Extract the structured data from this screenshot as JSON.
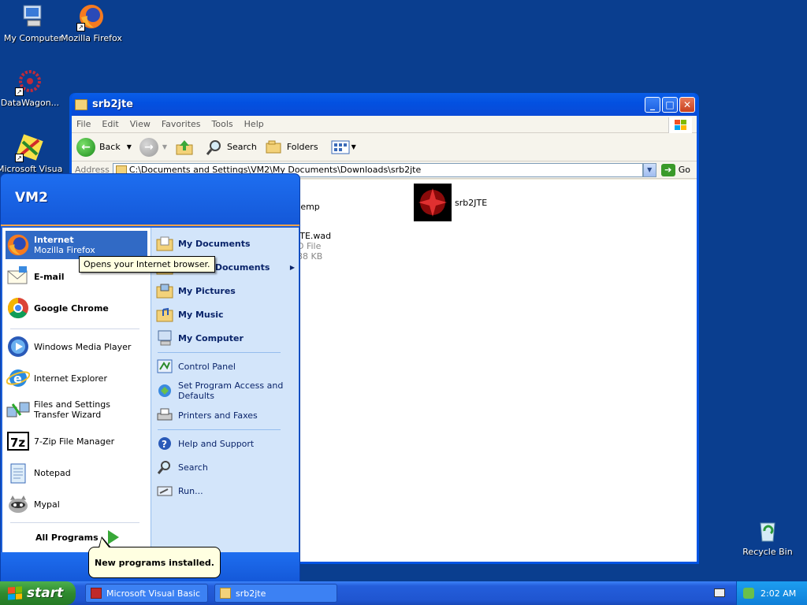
{
  "desktop": {
    "icons": [
      {
        "label": "My Computer",
        "icon": "my-computer-icon"
      },
      {
        "label": "Mozilla Firefox",
        "icon": "firefox-icon"
      },
      {
        "label": "DataWagon...",
        "icon": "datawagon-icon"
      },
      {
        "label": "Microsoft Visual...",
        "icon": "visual-basic-icon"
      },
      {
        "label": "Recycle Bin",
        "icon": "recycle-bin-icon"
      }
    ]
  },
  "window": {
    "title": "srb2jte",
    "menu": [
      "File",
      "Edit",
      "View",
      "Favorites",
      "Tools",
      "Help"
    ],
    "toolbar": {
      "back": "Back",
      "search": "Search",
      "folders": "Folders"
    },
    "address": {
      "label": "Address",
      "value": "C:\\Documents and Settings\\VM2\\My Documents\\Downloads\\srb2jte",
      "go": "Go"
    },
    "files": [
      {
        "name": "temp",
        "type": "",
        "size": ""
      },
      {
        "name": "srb2JTE",
        "type": "",
        "size": ""
      },
      {
        "name": "JTE.wad",
        "type": "D File",
        "size": "88 KB"
      }
    ]
  },
  "startmenu": {
    "user": "VM2",
    "pinned": [
      {
        "name": "Internet",
        "sub": "Mozilla Firefox"
      },
      {
        "name": "E-mail",
        "sub": ""
      }
    ],
    "programs": [
      "Google Chrome",
      "Windows Media Player",
      "Internet Explorer",
      "Files and Settings Transfer Wizard",
      "7-Zip File Manager",
      "Notepad",
      "Mypal"
    ],
    "all_programs": "All Programs",
    "places": [
      {
        "name": "My Documents",
        "bold": true
      },
      {
        "name": "Recent Documents",
        "bold": true
      },
      {
        "name": "My Pictures",
        "bold": true
      },
      {
        "name": "My Music",
        "bold": true
      },
      {
        "name": "My Computer",
        "bold": true
      },
      {
        "name": "Control Panel",
        "bold": false
      },
      {
        "name": "Set Program Access and Defaults",
        "bold": false
      },
      {
        "name": "Printers and Faxes",
        "bold": false
      },
      {
        "name": "Help and Support",
        "bold": false
      },
      {
        "name": "Search",
        "bold": false
      },
      {
        "name": "Run...",
        "bold": false
      }
    ]
  },
  "tooltip": "Opens your Internet browser.",
  "balloon": "New programs installed.",
  "taskbar": {
    "start": "start",
    "tasks": [
      "Microsoft Visual Basic",
      "srb2jte"
    ],
    "clock": "2:02 AM"
  }
}
